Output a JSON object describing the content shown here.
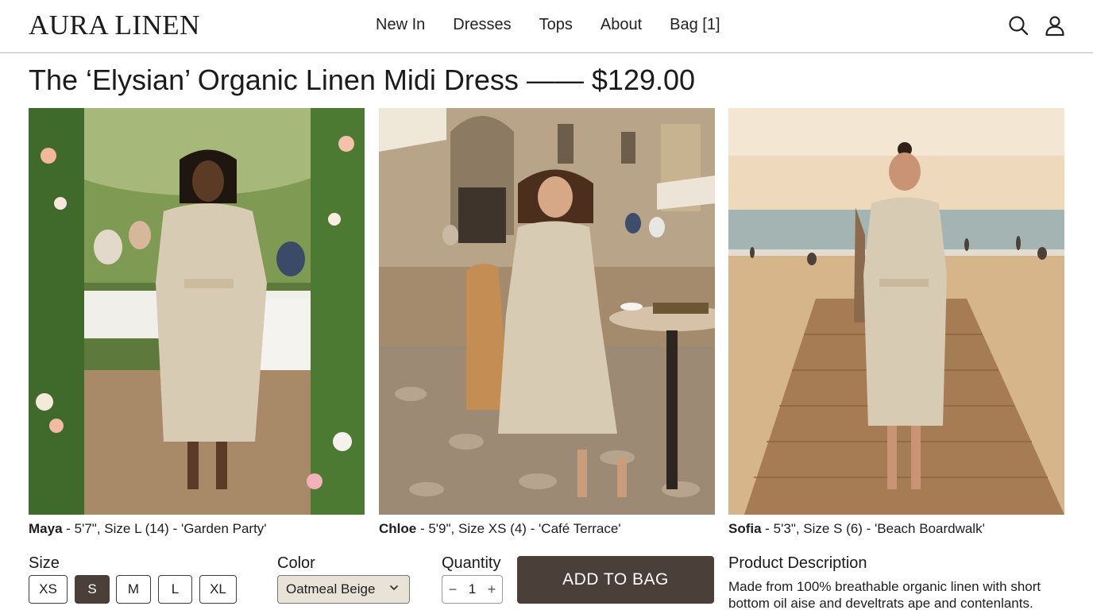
{
  "header": {
    "logo": "AURA LINEN",
    "nav": [
      "New In",
      "Dresses",
      "Tops",
      "About",
      "Bag [1]"
    ],
    "icons": [
      "search-icon",
      "user-icon"
    ]
  },
  "product": {
    "title": "The ‘Elysian’ Organic Linen Midi Dress —— $129.00"
  },
  "gallery": [
    {
      "model": "Maya",
      "details": " - 5'7\", Size L (14) - 'Garden Party'"
    },
    {
      "model": "Chloe",
      "details": " - 5'9\", Size XS (4) - 'Café Terrace'"
    },
    {
      "model": "Sofia",
      "details": " - 5'3\", Size S (6) - 'Beach Boardwalk'"
    }
  ],
  "size": {
    "label": "Size",
    "options": [
      "XS",
      "S",
      "M",
      "L",
      "XL"
    ],
    "selected": "S"
  },
  "color": {
    "label": "Color",
    "selected": "Oatmeal Beige"
  },
  "quantity": {
    "label": "Quantity",
    "value": "1",
    "minus": "−",
    "plus": "+"
  },
  "add_to_bag": "ADD TO BAG",
  "description": {
    "title": "Product Description",
    "text": "Made from 100% breathable organic linen with short bottom oil aise and develtrats ape and contenlants."
  },
  "colors": {
    "accent": "#4a3f39",
    "select_bg": "#e9e2d6",
    "dress": "#d8cbb4"
  }
}
